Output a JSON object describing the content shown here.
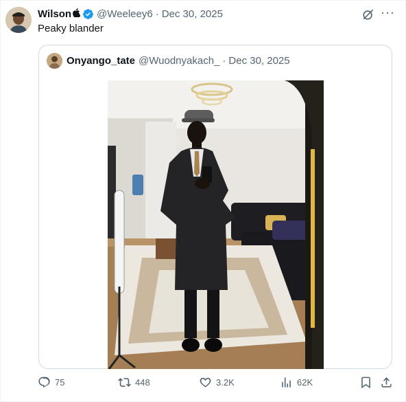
{
  "tweet": {
    "author_name": "Wilson",
    "author_badge_emoji": "",
    "author_handle": "@Weeleey6",
    "separator": "·",
    "date": "Dec 30, 2025",
    "text": "Peaky blander",
    "verified_color": "#1d9bf0"
  },
  "quoted_tweet": {
    "author_name": "Onyango_tate",
    "author_handle": "@Wuodnyakach_",
    "separator": "·",
    "date": "Dec 30, 2025"
  },
  "actions": {
    "replies": "75",
    "reposts": "448",
    "likes": "3.2K",
    "views": "62K"
  },
  "icons": [
    "grok-icon",
    "more-icon",
    "reply-icon",
    "repost-icon",
    "like-icon",
    "views-icon",
    "bookmark-icon",
    "share-icon"
  ],
  "colors": {
    "text": "#0f1419",
    "secondary": "#536471",
    "border": "#cfd9de",
    "accent": "#1d9bf0"
  }
}
